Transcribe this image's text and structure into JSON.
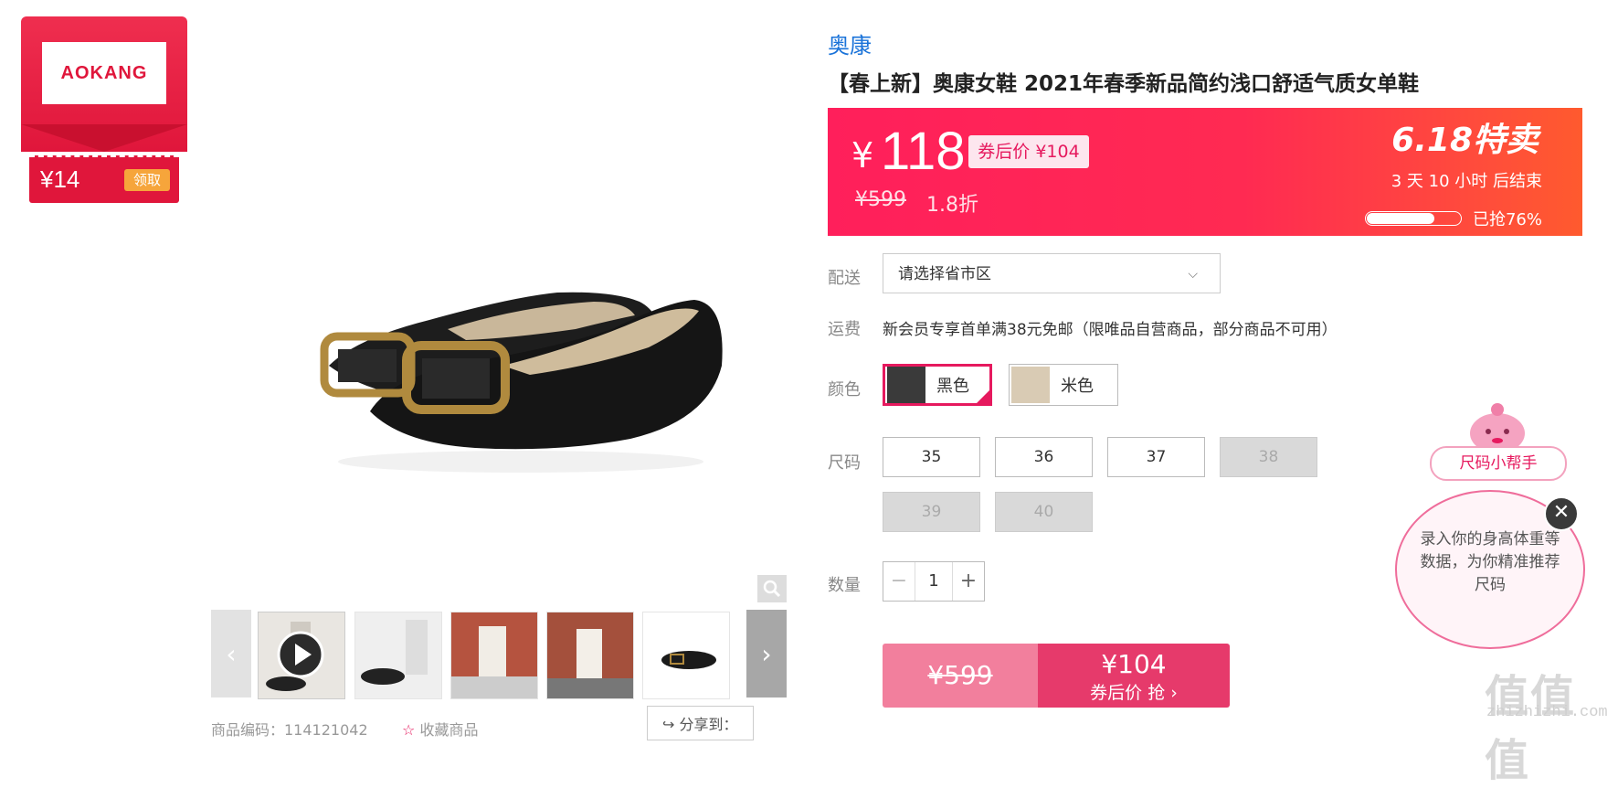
{
  "coupon": {
    "brand_logo_text": "AOKANG",
    "price": "¥14",
    "get_label": "领取"
  },
  "product": {
    "brand": "奥康",
    "title": "【春上新】奥康女鞋 2021年春季新品简约浅口舒适气质女单鞋"
  },
  "price_banner": {
    "yen": "¥",
    "price": "118",
    "after_coupon": "券后价 ¥104",
    "original_price": "¥599",
    "discount": "1.8折",
    "event_label": "6.18特卖",
    "countdown": "3  天 10 小时 后结束",
    "progress_fraction": 0.76,
    "progress_text": "已抢76%"
  },
  "delivery": {
    "label": "配送",
    "placeholder": "请选择省市区"
  },
  "shipping": {
    "label": "运费",
    "text": "新会员专享首单满38元免邮（限唯品自营商品，部分商品不可用）"
  },
  "color": {
    "label": "颜色",
    "options": [
      {
        "name": "黑色",
        "selected": true
      },
      {
        "name": "米色",
        "selected": false
      }
    ]
  },
  "size": {
    "label": "尺码",
    "options": [
      {
        "value": "35",
        "available": true
      },
      {
        "value": "36",
        "available": true
      },
      {
        "value": "37",
        "available": true
      },
      {
        "value": "38",
        "available": false
      },
      {
        "value": "39",
        "available": false
      },
      {
        "value": "40",
        "available": false
      }
    ]
  },
  "quantity": {
    "label": "数量",
    "value": "1",
    "minus": "−",
    "plus": "+"
  },
  "buy": {
    "original": "¥599",
    "price": "¥104",
    "action": "券后价 抢 ›"
  },
  "size_helper": {
    "title": "尺码小帮手",
    "text": "录入你的身高体重等数据，为你精准推荐尺码",
    "close": "✕"
  },
  "bottom": {
    "item_no": "商品编码：114121042",
    "favorite": "收藏商品",
    "share": "分享到："
  },
  "watermark": {
    "text": "值值值",
    "url": "zhizhizhi.com"
  },
  "colors": {
    "accent": "#e6195e",
    "banner_start": "#ff1f5b",
    "banner_end": "#ff5a2e",
    "brand_link": "#1a73d9"
  }
}
